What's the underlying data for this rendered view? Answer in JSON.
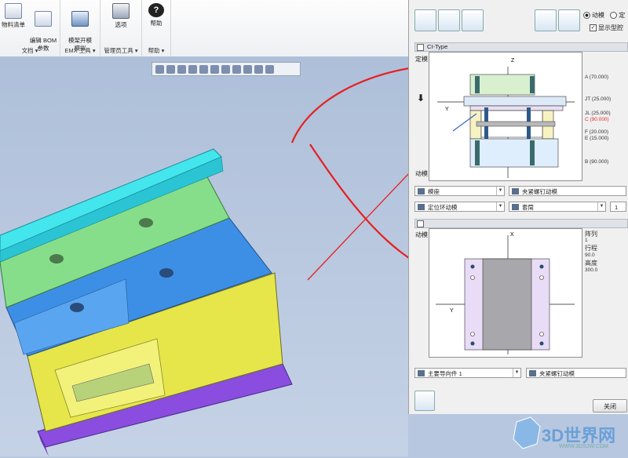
{
  "ribbon": {
    "groups": [
      {
        "label": "文档",
        "buttons": [
          "物料清单",
          "编辑 BOM\n参数"
        ]
      },
      {
        "label": "EMX 工具",
        "buttons": [
          "模架开模\n模拟"
        ]
      },
      {
        "label": "管理员工具",
        "buttons": [
          "选项"
        ]
      },
      {
        "label": "帮助",
        "buttons": [
          "帮助"
        ]
      }
    ]
  },
  "panel": {
    "radio_moving": "动模",
    "radio_fixed": "定",
    "checkbox_show_cavity": "显示型腔",
    "section1_title": "CI-Type",
    "section1_fixed_label": "定模",
    "section1_moving_label": "动模",
    "top_dims": [
      {
        "text": "A (70.000)",
        "color": "#333333"
      },
      {
        "text": "JT (25.000)",
        "color": "#333333"
      },
      {
        "text": "JL (25.000)",
        "color": "#333333"
      },
      {
        "text": "C (90.000)",
        "color": "#e03030"
      },
      {
        "text": "F (20.000)",
        "color": "#333333"
      },
      {
        "text": "E (15.000)",
        "color": "#333333"
      },
      {
        "text": "B (90.000)",
        "color": "#333333"
      }
    ],
    "axis_z": "Z",
    "axis_y": "Y",
    "axis_x": "X",
    "combo_row1_left": "模座",
    "combo_row1_right": "夹紧螺钉动模",
    "combo_row2_left": "定位环动模",
    "combo_row2_right": "套筒",
    "combo_row2_count": "1",
    "section2_moving_label": "动模",
    "bottom_dims": [
      "阵列",
      "1",
      "行程",
      "90.0",
      "高度",
      "300.0"
    ],
    "combo_row3_left": "主要导向件 1",
    "combo_row3_right": "夹紧螺钉动模",
    "close_label": "关闭"
  },
  "watermark": {
    "text": "3D世界网",
    "url": "WWW.3DSJW.COM"
  },
  "colors": {
    "accent_red": "#e03030",
    "panel_bg": "#f0f0f0",
    "viewport_bg": "#b7c7df"
  }
}
